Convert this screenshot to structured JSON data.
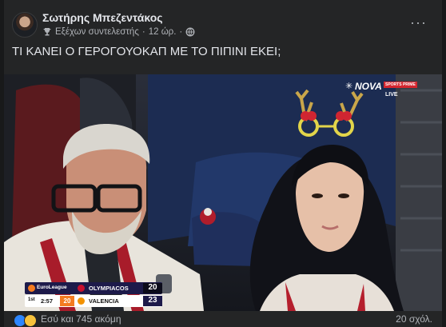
{
  "post": {
    "author": "Σωτήρης Μπεζεντάκος",
    "badge": "Εξέχων συντελεστής",
    "separator": "·",
    "time": "12 ώρ.",
    "text": "ΤΙ ΚΑΝΕΙ Ο ΓΕΡΟΓΟΥΟΚΑΠ ΜΕ ΤΟ ΠΙΠΙΝΙ ΕΚΕΙ;",
    "more_label": "···"
  },
  "broadcast": {
    "channel_logo": "NOVA",
    "channel_sub": "SPORTS PRIME",
    "live": "LIVE"
  },
  "scoreboard": {
    "league": "EuroLeague",
    "quarter": "1st",
    "clock": "2:57",
    "shot_clock": "20",
    "home": {
      "name": "OLYMPIACOS",
      "score": "20",
      "color": "#c8102e"
    },
    "away": {
      "name": "VALENCIA",
      "score": "23",
      "color": "#f39200"
    }
  },
  "footer": {
    "reactions_text": "Εσύ και 745 ακόμη",
    "comments_text": "20 σχόλ."
  },
  "icons": {
    "badge": "trophy-icon",
    "audience": "globe-icon",
    "more": "more-icon"
  }
}
